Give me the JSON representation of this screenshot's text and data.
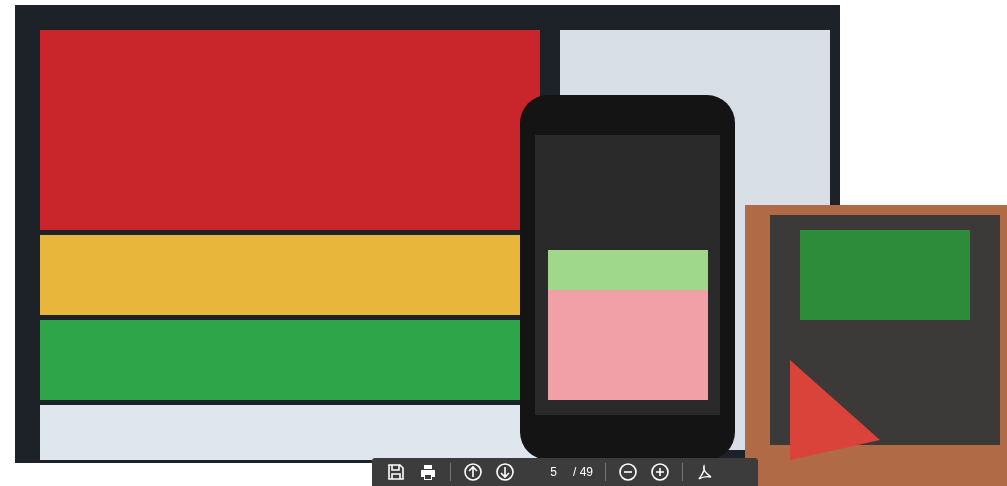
{
  "toolbar": {
    "page": "5",
    "page_count": "/ 49"
  }
}
